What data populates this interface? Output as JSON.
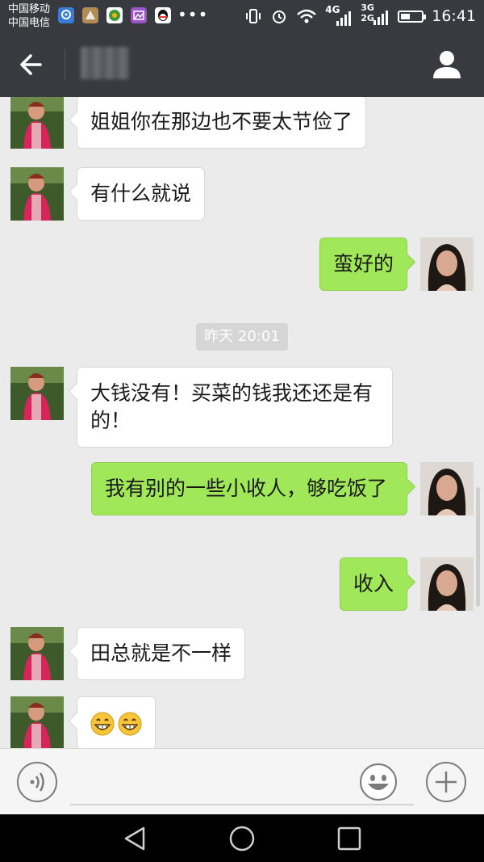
{
  "status_bar": {
    "carrier_1": "中国移动",
    "carrier_2": "中国电信",
    "network_1": "4G",
    "network_2": "3G",
    "network_3": "2G",
    "time": "16:41",
    "battery_level": 0.45
  },
  "header": {
    "title": "▒▒▒",
    "back_icon": "arrow-left-icon",
    "profile_icon": "user-icon"
  },
  "messages": [
    {
      "side": "left",
      "text": "姐姐你在那边也不要太节俭了"
    },
    {
      "side": "left",
      "text": "有什么就说"
    },
    {
      "side": "right",
      "text": "蛮好的"
    },
    {
      "side": "left",
      "text": "大钱没有！买菜的钱我还还是有的！"
    },
    {
      "side": "right",
      "text": "我有别的一些小收人，够吃饭了"
    },
    {
      "side": "right",
      "text": "收入"
    },
    {
      "side": "left",
      "text": "田总就是不一样"
    },
    {
      "side": "left",
      "text": "",
      "emoji": [
        "grin-emoji",
        "grin-emoji"
      ]
    }
  ],
  "timestamp": "昨天 20:01",
  "input_bar": {
    "placeholder": "",
    "voice_icon": "voice-icon",
    "emoji_icon": "smiley-icon",
    "plus_icon": "plus-icon"
  },
  "colors": {
    "header_bg": "#393a3f",
    "chat_bg": "#ebebeb",
    "outgoing_bubble": "#a0e759",
    "incoming_bubble": "#ffffff"
  }
}
